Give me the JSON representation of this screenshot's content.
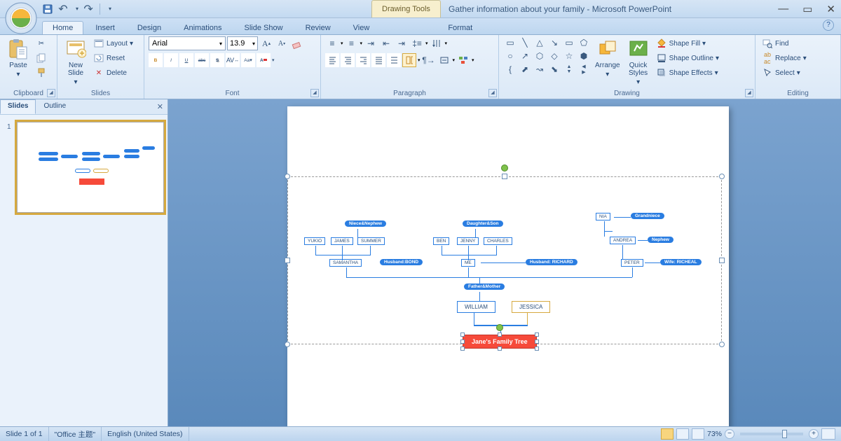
{
  "app": {
    "contextual_tab": "Drawing Tools",
    "title": "Gather information about your family - Microsoft PowerPoint"
  },
  "tabs": {
    "home": "Home",
    "insert": "Insert",
    "design": "Design",
    "animations": "Animations",
    "slideshow": "Slide Show",
    "review": "Review",
    "view": "View",
    "format": "Format"
  },
  "groups": {
    "clipboard": "Clipboard",
    "slides": "Slides",
    "font": "Font",
    "paragraph": "Paragraph",
    "drawing": "Drawing",
    "editing": "Editing"
  },
  "clipboard": {
    "paste": "Paste"
  },
  "slides": {
    "new": "New\nSlide",
    "layout": "Layout",
    "reset": "Reset",
    "delete": "Delete"
  },
  "font": {
    "name": "Arial",
    "size": "13.9",
    "bold": "B",
    "italic": "I",
    "underline": "U"
  },
  "drawing": {
    "arrange": "Arrange",
    "quick": "Quick\nStyles",
    "fill": "Shape Fill",
    "outline": "Shape Outline",
    "effects": "Shape Effects"
  },
  "editing": {
    "find": "Find",
    "replace": "Replace",
    "select": "Select"
  },
  "panel": {
    "slides": "Slides",
    "outline": "Outline"
  },
  "tree": {
    "root": "Jane's Family Tree",
    "william": "WILLIAM",
    "jessica": "JESSICA",
    "fm": "Father&Mother",
    "samantha": "SAMANTHA",
    "hbond": "Husband:BOND",
    "nn": "Niece&Nephew",
    "yukio": "YUKIO",
    "james": "JAMES",
    "summer": "SUMMER",
    "me": "ME",
    "hrichard": "Husband: RICHARD",
    "ds": "Daughter&Son",
    "ben": "BEN",
    "jenny": "JENNY",
    "charles": "CHARLES",
    "peter": "PETER",
    "wricheal": "Wife: RICHEAL",
    "andrea": "ANDREA",
    "nephew": "Nephew",
    "nia": "NIA",
    "grandniece": "Grandniece"
  },
  "status": {
    "slide": "Slide 1 of 1",
    "theme": "\"Office 主题\"",
    "lang": "English (United States)",
    "zoom": "73%"
  }
}
